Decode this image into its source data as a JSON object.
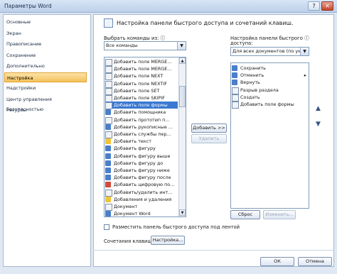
{
  "window": {
    "title": "Параметры Word"
  },
  "sidebar": {
    "items": [
      {
        "label": "Основные"
      },
      {
        "label": "Экран"
      },
      {
        "label": "Правописание"
      },
      {
        "label": "Сохранение"
      },
      {
        "label": "Дополнительно"
      },
      {
        "label": "Настройка",
        "active": true
      },
      {
        "label": "Надстройки"
      },
      {
        "label": "Центр управления безопасностью"
      },
      {
        "label": "Ресурсы"
      }
    ]
  },
  "header": {
    "title": "Настройка панели быстрого доступа и сочетаний клавиш."
  },
  "left": {
    "choose_label": "Выбрать команды из:",
    "choose_value": "Все команды",
    "commands": [
      {
        "label": "Добавить поле MERGE...",
        "icon": "box"
      },
      {
        "label": "Добавить поле MERGE...",
        "icon": "box"
      },
      {
        "label": "Добавить поле NEXT",
        "icon": "box"
      },
      {
        "label": "Добавить поле NEXTIF",
        "icon": "box"
      },
      {
        "label": "Добавить поле SET",
        "icon": "box"
      },
      {
        "label": "Добавить поле SKIPIF",
        "icon": "box"
      },
      {
        "label": "Добавить поле формы",
        "icon": "box",
        "selected": true
      },
      {
        "label": "Добавить помощника",
        "icon": "blue"
      },
      {
        "label": "Добавить прототип п...",
        "icon": "box"
      },
      {
        "label": "Добавить рукописные ...",
        "icon": "blue"
      },
      {
        "label": "Добавить службы пер...",
        "icon": "box"
      },
      {
        "label": "Добавить текст",
        "icon": "yellow"
      },
      {
        "label": "Добавить фигуру",
        "icon": "blue"
      },
      {
        "label": "Добавить фигуру выше",
        "icon": "blue"
      },
      {
        "label": "Добавить фигуру до",
        "icon": "blue"
      },
      {
        "label": "Добавить фигуру ниже",
        "icon": "blue"
      },
      {
        "label": "Добавить фигуру после",
        "icon": "blue"
      },
      {
        "label": "Добавить цифровую по...",
        "icon": "red"
      },
      {
        "label": "Добавить/удалить инт...",
        "icon": "box"
      },
      {
        "label": "Добавления и удаления",
        "icon": "yellow"
      },
      {
        "label": "Документ",
        "icon": "box"
      },
      {
        "label": "Документ Word",
        "icon": "blue"
      }
    ]
  },
  "middle": {
    "add_label": "Добавить >>",
    "remove_label": "Удалить"
  },
  "right": {
    "custom_label_1": "Настройка панели быстрого",
    "custom_label_2": "доступа:",
    "custom_value": "Для всех документов (по умолч...",
    "items": [
      {
        "label": "Сохранить",
        "icon": "blue"
      },
      {
        "label": "Отменить",
        "icon": "blue",
        "has_arrow": true
      },
      {
        "label": "Вернуть",
        "icon": "blue"
      },
      {
        "label": "Разрыв раздела",
        "icon": "box"
      },
      {
        "label": "Создать",
        "icon": "box"
      },
      {
        "label": "Добавить поле формы",
        "icon": "box"
      }
    ],
    "reset_label": "Сброс",
    "modify_label": "Изменить..."
  },
  "options": {
    "below_ribbon_label": "Разместить панель быстрого доступа под лентой",
    "shortcuts_label": "Сочетания клавиш:",
    "shortcuts_button": "Настройка..."
  },
  "footer": {
    "ok_label": "ОК",
    "cancel_label": "Отмена"
  },
  "icons": {
    "info": "ⓘ",
    "up": "▲",
    "down": "▼"
  }
}
